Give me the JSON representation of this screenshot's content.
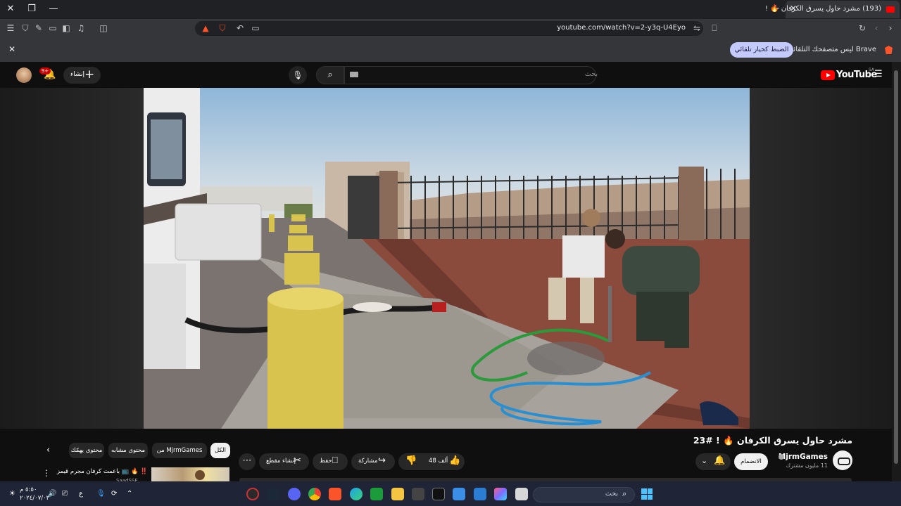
{
  "browser": {
    "tab": {
      "title": "(193) مشرد حاول يسرق الكرفان 🔥 !"
    },
    "url": "youtube.com/watch?v=2-y3q-U4Eyo",
    "infobar": {
      "message": "Brave ليس متصفحك التلقائي.",
      "button": "الضبط كخيار تلقائي"
    }
  },
  "youtube": {
    "logo_text": "YouTube",
    "region": "SA",
    "search_placeholder": "بحث",
    "create_label": "إنشاء",
    "notification_badge": "9+",
    "video": {
      "title": "مشرد حاول يسرق الكرفان 🔥 ! #23",
      "channel": "MjrmGames",
      "subscribers": "11 مليون مشترك",
      "join_label": "الانضمام",
      "likes": "48 ألف",
      "share_label": "مشاركة",
      "save_label": "حفظ",
      "clip_label": "إنشاء مقطع"
    },
    "chips": {
      "all": "الكل",
      "from_channel": "من MjrmGames",
      "similar": "محتوى مشابه",
      "for_you": "محتوى يهمّك"
    },
    "recommendation": {
      "title": "‼️ 🔥 📺 باعمت كرفان مجرم قيمز",
      "channel": "SaadSSE"
    }
  },
  "taskbar": {
    "search_label": "بحث",
    "time": "٥:٥٠ م",
    "date": "٢٠٢٤/٠٧/٠٣",
    "lang": "ع"
  },
  "colors": {
    "accent": "#ff0000",
    "brave": "#fb542b",
    "infobar_button": "#c5cafd",
    "windows": "#4cc2ff"
  }
}
